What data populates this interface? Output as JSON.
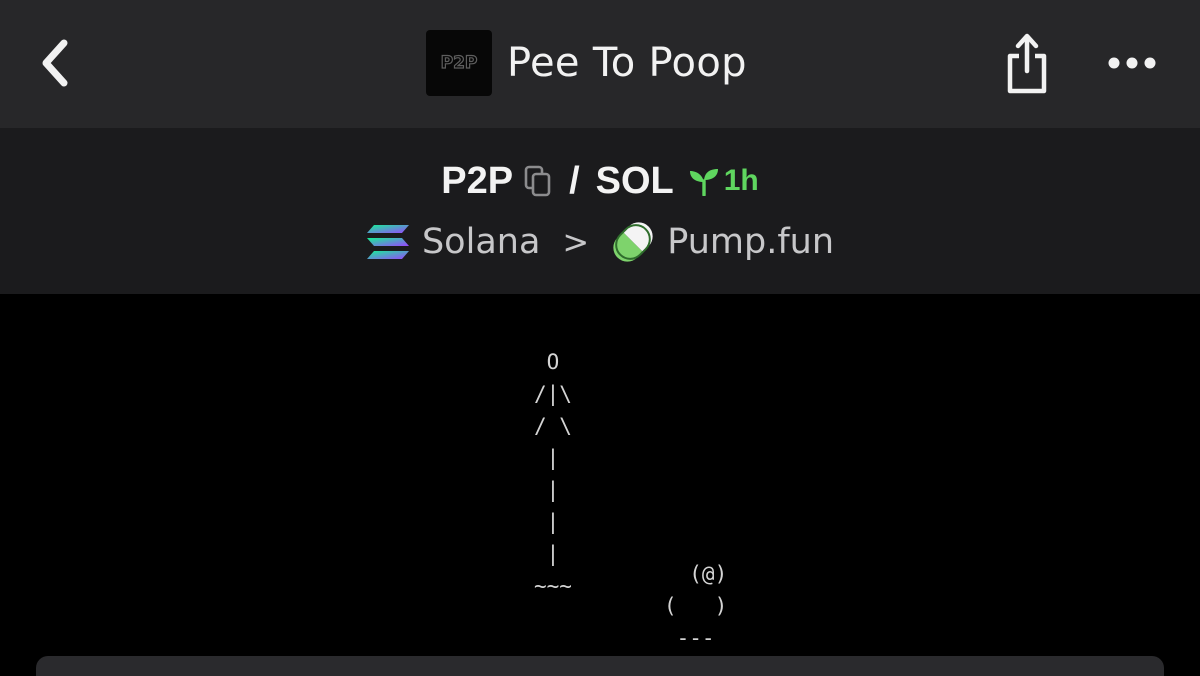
{
  "header": {
    "back_icon": "chevron-left-icon",
    "title": "Pee To Poop",
    "logo_text": "P2P",
    "share_icon": "share-icon",
    "more_icon": "ellipsis-icon"
  },
  "pair": {
    "base": "P2P",
    "quote": "SOL",
    "separator": "/",
    "copy_icon": "copy-icon",
    "age": "1h",
    "age_icon": "seedling-icon"
  },
  "breadcrumb": {
    "chain": "Solana",
    "chain_icon": "solana-logo-icon",
    "separator": ">",
    "dex": "Pump.fun",
    "dex_icon": "pill-icon"
  },
  "art": {
    "figure": " O\n/|\\\n/ \\\n |\n |\n |\n |\n~~~",
    "poop": "  (@)\n(   )\n ---"
  },
  "colors": {
    "header_bg": "#272729",
    "pair_bg": "#1b1b1d",
    "content_bg": "#000000",
    "age_green": "#5fd65f",
    "solana_purple": "#9945ff",
    "solana_teal": "#14f195"
  }
}
